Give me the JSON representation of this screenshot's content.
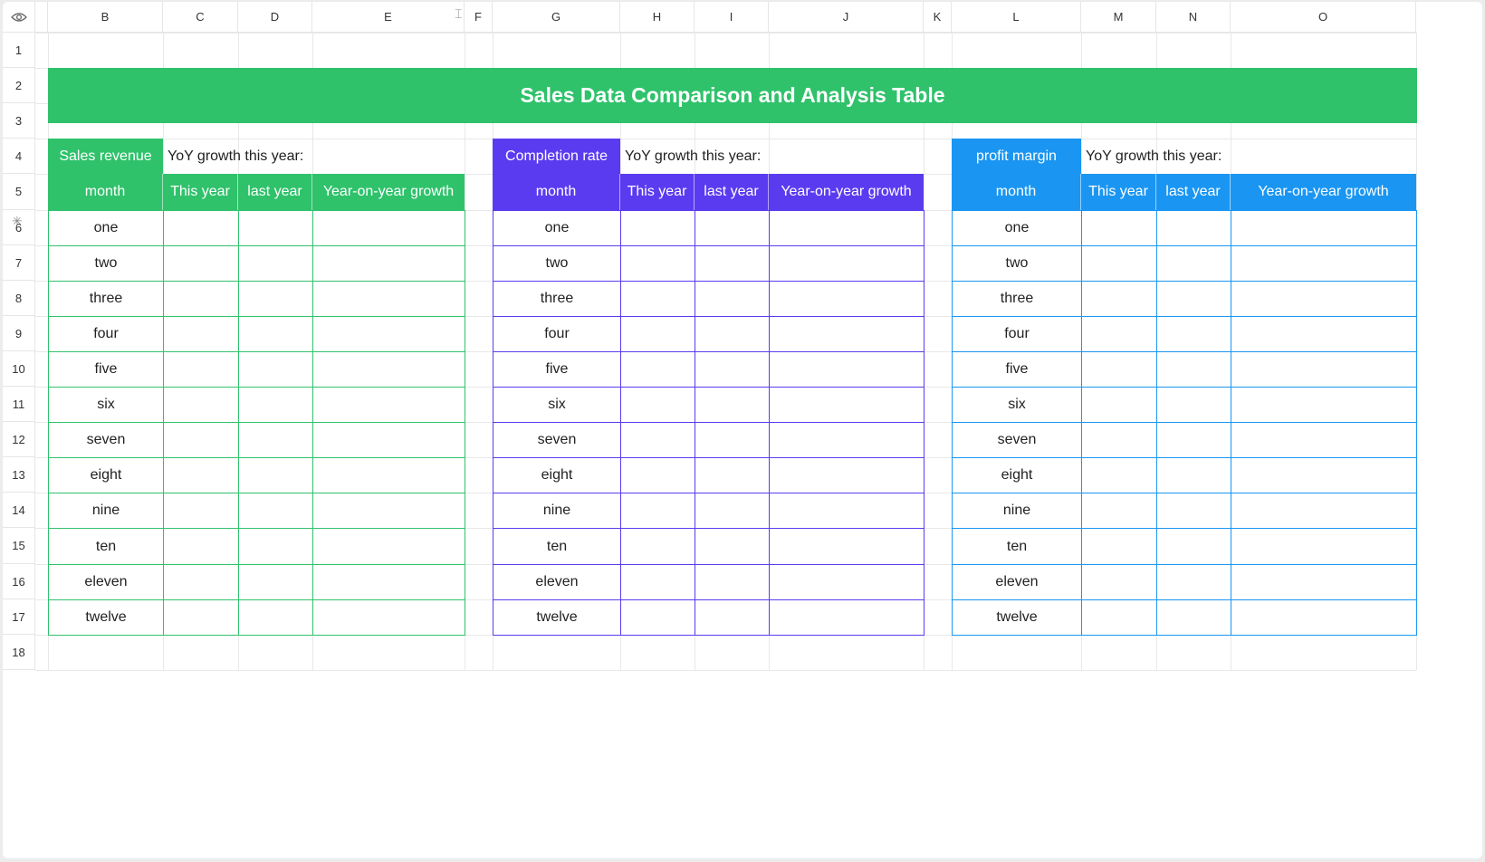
{
  "column_headers": [
    "B",
    "C",
    "D",
    "E",
    "F",
    "G",
    "H",
    "I",
    "J",
    "K",
    "L",
    "M",
    "N",
    "O"
  ],
  "row_headers": [
    "1",
    "2",
    "3",
    "4",
    "5",
    "6",
    "7",
    "8",
    "9",
    "10",
    "11",
    "12",
    "13",
    "14",
    "15",
    "16",
    "17",
    "18"
  ],
  "title": "Sales Data Comparison and Analysis Table",
  "months": [
    "one",
    "two",
    "three",
    "four",
    "five",
    "six",
    "seven",
    "eight",
    "nine",
    "ten",
    "eleven",
    "twelve"
  ],
  "tables": [
    {
      "label": "Sales revenue",
      "yoy_label": "YoY growth this year:",
      "columns": [
        "month",
        "This year",
        "last year",
        "Year-on-year growth"
      ],
      "color": "#2fc26b"
    },
    {
      "label": "Completion rate",
      "yoy_label": "YoY growth this year:",
      "columns": [
        "month",
        "This year",
        "last year",
        "Year-on-year growth"
      ],
      "color": "#5b3bf0"
    },
    {
      "label": "profit margin",
      "yoy_label": "YoY growth this year:",
      "columns": [
        "month",
        "This year",
        "last year",
        "Year-on-year growth"
      ],
      "color": "#1a96f2"
    }
  ],
  "icons": {
    "corner": "eye-icon",
    "column_resize": "column-resize-icon",
    "row_resize": "row-resize-icon"
  }
}
